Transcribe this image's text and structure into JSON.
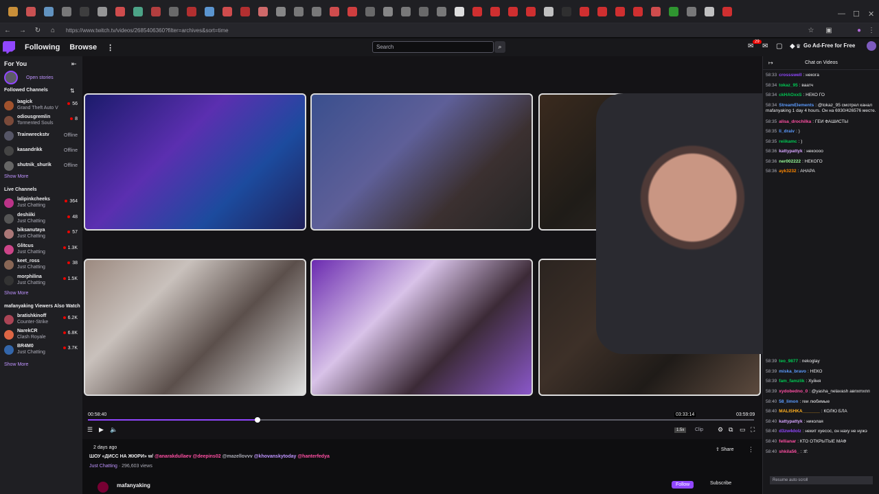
{
  "browser": {
    "url": "https://www.twitch.tv/videos/2685406360?filter=archives&sort=time",
    "tab_colors": [
      "#e8a33d",
      "#e85b5b",
      "#6fa8dc",
      "#888888",
      "#444444",
      "#aaaaaa",
      "#e55",
      "#5b9",
      "#c44",
      "#777",
      "#c33",
      "#6ae",
      "#e55",
      "#c33",
      "#e77",
      "#999",
      "#888",
      "#888",
      "#e55",
      "#e44",
      "#777",
      "#999",
      "#888",
      "#777",
      "#888",
      "#fff",
      "#e33",
      "#e33",
      "#e33",
      "#e33",
      "#ddd",
      "#333",
      "#e33",
      "#e33",
      "#e33",
      "#e33",
      "#e55",
      "#3a3",
      "#888",
      "#ddd",
      "#e33"
    ]
  },
  "topnav": {
    "following": "Following",
    "browse": "Browse",
    "search_placeholder": "Search",
    "notifications": "29",
    "ad_free": "Go Ad-Free for Free"
  },
  "sidebar": {
    "title": "For You",
    "open_stories": "Open stories",
    "followed_title": "Followed Channels",
    "followed": [
      {
        "name": "bagick",
        "sub": "Grand Theft Auto V",
        "status": "56",
        "live": true,
        "color": "#a0522d"
      },
      {
        "name": "odiousgremlin",
        "sub": "Tormented Souls",
        "status": "8",
        "live": true,
        "color": "#7a4a3a"
      },
      {
        "name": "Trainwreckstv",
        "sub": "",
        "status": "Offline",
        "live": false,
        "color": "#556"
      },
      {
        "name": "kasandrikk",
        "sub": "",
        "status": "Offline",
        "live": false,
        "color": "#444"
      },
      {
        "name": "shutnik_shurik",
        "sub": "",
        "status": "Offline",
        "live": false,
        "color": "#666"
      }
    ],
    "show_more": "Show More",
    "live_title": "Live Channels",
    "live": [
      {
        "name": "lalipinkcheeks",
        "sub": "Just Chatting",
        "status": "364",
        "color": "#b38"
      },
      {
        "name": "deshiiki",
        "sub": "Just Chatting",
        "status": "48",
        "color": "#555"
      },
      {
        "name": "biksanutaya",
        "sub": "Just Chatting",
        "status": "57",
        "color": "#a77"
      },
      {
        "name": "Glitcus",
        "sub": "Just Chatting",
        "status": "1.3K",
        "color": "#c48"
      },
      {
        "name": "keet_ross",
        "sub": "Just Chatting",
        "status": "38",
        "color": "#865"
      },
      {
        "name": "morphilina",
        "sub": "Just Chatting",
        "status": "1.5K",
        "color": "#333"
      }
    ],
    "also_title": "mafanyaking Viewers Also Watch",
    "also": [
      {
        "name": "bratishkinoff",
        "sub": "Counter-Strike",
        "status": "6.2K",
        "color": "#a45"
      },
      {
        "name": "NarekCR",
        "sub": "Clash Royale",
        "status": "6.8K",
        "color": "#d64"
      },
      {
        "name": "BR4M0",
        "sub": "Just Chatting",
        "status": "3.7K",
        "color": "#36a"
      }
    ]
  },
  "player": {
    "progress": 0.255,
    "time_current": "00:58:40",
    "time_hover": "03:33:14",
    "time_total": "03:59:09",
    "quality_badge": "1.5x",
    "clip": "Clip",
    "video_tiles": [
      {
        "bg": "linear-gradient(135deg,#1b1b6b,#5b2fb0 40%,#1c4b9e 70%,#20205a)"
      },
      {
        "bg": "linear-gradient(135deg,#3a4f8e,#5e5f98 40%,#3b3030 70%,#252525)"
      },
      {
        "bg": "linear-gradient(135deg,#3a2a1e,#1f1c18 40%,#2d2722 70%,#4b3a2c)"
      },
      {
        "bg": "linear-gradient(135deg,#9c8a80,#c9c1bc 30%,#5b4f4b 60%,#e0e0e0)"
      },
      {
        "bg": "linear-gradient(135deg,#6b2bb0,#d8c2e8 35%,#3b2a36 65%,#8a57c9)"
      },
      {
        "bg": "linear-gradient(135deg,#2b2420,#3d3028 35%,#1f1b18 65%,#5c4a3e)"
      }
    ]
  },
  "info": {
    "date": "2 days ago",
    "title_prefix": "ШОУ «ДИСС НА ЖЮРИ» w/",
    "mentions": [
      "@anarakdullaev",
      "@deepins02",
      "@mazellovvv",
      "@khovanskytoday",
      "@hanterfedya"
    ],
    "category": "Just Chatting",
    "views": "296,603 views",
    "share": "Share",
    "channel": "mafanyaking",
    "follow": "Follow",
    "subscribe": "Subscribe"
  },
  "chat": {
    "header": "Chat on Videos",
    "resume": "Resume auto scroll",
    "lines": [
      {
        "t": "58:33",
        "u": "crossswell",
        "c": "#9147ff",
        "m": ": некогa"
      },
      {
        "t": "58:34",
        "u": "tokaz_95",
        "c": "#00c853",
        "m": ": ваатч"
      },
      {
        "t": "58:34",
        "u": "ckHAOxxS",
        "c": "#00c853",
        "m": ": НЕКО ГО"
      },
      {
        "t": "58:34",
        "u": "StreamElements",
        "c": "#5c9cff",
        "m": ": @tokaz_95 смотрел канал mafanyaking 1 day 4 hours. Он на 6930/426576 месте."
      },
      {
        "t": "58:35",
        "u": "alisa_drochilka",
        "c": "#ff4fa3",
        "m": ": ГЕИ ФАШИСТЫ"
      },
      {
        "t": "58:35",
        "u": "li_draiv",
        "c": "#5c9cff",
        "m": ": )"
      },
      {
        "t": "58:35",
        "u": "reiikamc",
        "c": "#00c853",
        "m": ": )"
      },
      {
        "t": "58:36",
        "u": "kattypattyk",
        "c": "#d6a5ff",
        "m": ": некоооо"
      },
      {
        "t": "58:36",
        "u": "ner002222",
        "c": "#9f9",
        "m": ": НЕКОГО"
      },
      {
        "t": "58:36",
        "u": "ayk3232",
        "c": "#f80",
        "m": ": АНАРА"
      },
      {
        "t": "58:39",
        "u": "teo_9877",
        "c": "#00c853",
        "m": ": nekoglay"
      },
      {
        "t": "58:39",
        "u": "miska_bravo",
        "c": "#5c9cff",
        "m": ": НЕКО"
      },
      {
        "t": "58:39",
        "u": "fam_famzlik",
        "c": "#00c853",
        "m": ": Хуйня"
      },
      {
        "t": "58:39",
        "u": "xydobedno_0",
        "c": "#ff4fa3",
        "m": ": @yasha_nelavash авпхmхпп"
      },
      {
        "t": "58:40",
        "u": "58_limon",
        "c": "#5c9cff",
        "m": ": геи любимые"
      },
      {
        "t": "58:40",
        "u": "MALISHKA_______",
        "c": "#ffb020",
        "m": ": КОЛЮ БЛА"
      },
      {
        "t": "58:40",
        "u": "kattypattyk",
        "c": "#d6a5ff",
        "m": ": николая"
      },
      {
        "t": "58:40",
        "u": "d3zw4dolz",
        "c": "#9147ff",
        "m": ": некит хуесос, он наху не нужэ"
      },
      {
        "t": "58:40",
        "u": "fellianar",
        "c": "#ff4fa3",
        "m": ": КТО ОТКРЫТЫЕ МАФ"
      },
      {
        "t": "58:40",
        "u": "shkila56_",
        "c": "#ff4fa3",
        "m": ": :tf:"
      }
    ]
  }
}
